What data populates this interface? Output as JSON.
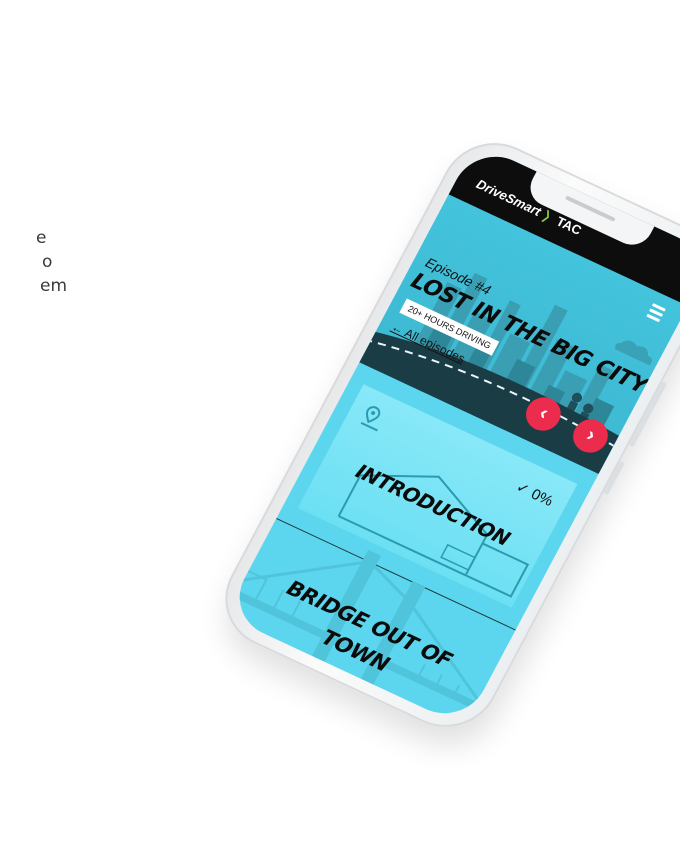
{
  "side_text": [
    "e",
    "o",
    "em"
  ],
  "header": {
    "logo_brand": "DriveSmart",
    "logo_partner": "TAC"
  },
  "episode": {
    "number": "Episode #4",
    "title": "LOST IN THE BIG CITY",
    "badge": "20+ HOURS DRIVING",
    "all_episodes_link": "← All episodes",
    "prev_glyph": "‹",
    "next_glyph": "›"
  },
  "sections": [
    {
      "title": "INTRODUCTION",
      "progress": "✓ 0%"
    },
    {
      "title_lines": [
        "BRIDGE OUT OF",
        "TOWN"
      ]
    }
  ],
  "colors": {
    "screen_bg": "#5cd6ee",
    "topbar": "#0d0d0d",
    "accent_red": "#ec2c4c",
    "logo_arrow": "#8bd23c"
  }
}
